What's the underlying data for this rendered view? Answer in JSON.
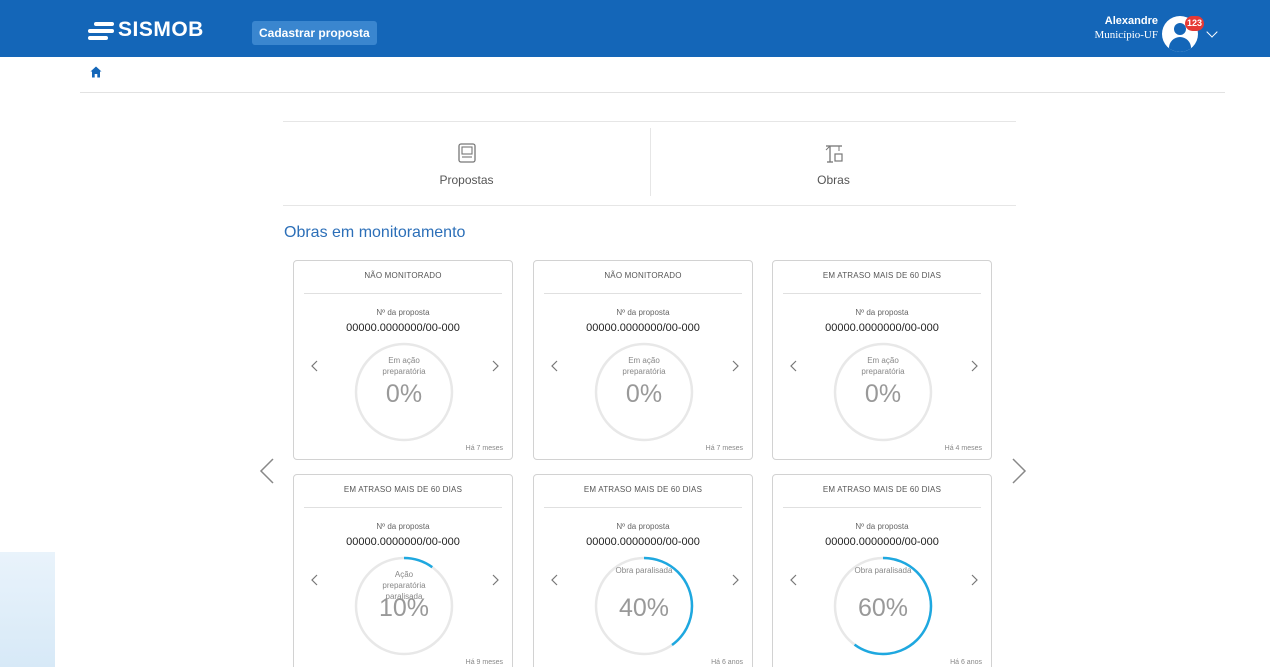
{
  "header": {
    "logo_text": "SISMOB",
    "cadastrar_label": "Cadastrar proposta",
    "user_name": "Alexandre",
    "user_org": "Município-UF",
    "notification_count": "123",
    "brand_color": "#1466b8"
  },
  "breadcrumb": {
    "home_icon": "home-icon"
  },
  "menu": {
    "propostas_label": "Propostas",
    "obras_label": "Obras"
  },
  "section": {
    "title": "Obras em monitoramento"
  },
  "cards": [
    {
      "status": "NÃO MONITORADO",
      "label": "Nº da proposta",
      "number": "00000.0000000/00-000",
      "state": "Em ação preparatória",
      "percent": "0%",
      "progress": 0,
      "time": "Há 7 meses"
    },
    {
      "status": "NÃO MONITORADO",
      "label": "Nº da proposta",
      "number": "00000.0000000/00-000",
      "state": "Em ação preparatória",
      "percent": "0%",
      "progress": 0,
      "time": "Há 7 meses"
    },
    {
      "status": "EM ATRASO MAIS DE 60 DIAS",
      "label": "Nº da proposta",
      "number": "00000.0000000/00-000",
      "state": "Em ação preparatória",
      "percent": "0%",
      "progress": 0,
      "time": "Há 4 meses"
    },
    {
      "status": "EM ATRASO MAIS DE 60 DIAS",
      "label": "Nº da proposta",
      "number": "00000.0000000/00-000",
      "state": "Ação preparatória paralisada",
      "percent": "10%",
      "progress": 0.1,
      "time": "Há 9 meses"
    },
    {
      "status": "EM ATRASO MAIS DE 60 DIAS",
      "label": "Nº da proposta",
      "number": "00000.0000000/00-000",
      "state": "Obra paralisada",
      "percent": "40%",
      "progress": 0.4,
      "time": "Há 6 anos"
    },
    {
      "status": "EM ATRASO MAIS DE 60 DIAS",
      "label": "Nº da proposta",
      "number": "00000.0000000/00-000",
      "state": "Obra paralisada",
      "percent": "60%",
      "progress": 0.6,
      "time": "Há 6 anos"
    }
  ],
  "colors": {
    "gauge_track": "#e8e8e8",
    "gauge_progress": "#1ea8e0",
    "section_title": "#2c6fb8"
  }
}
